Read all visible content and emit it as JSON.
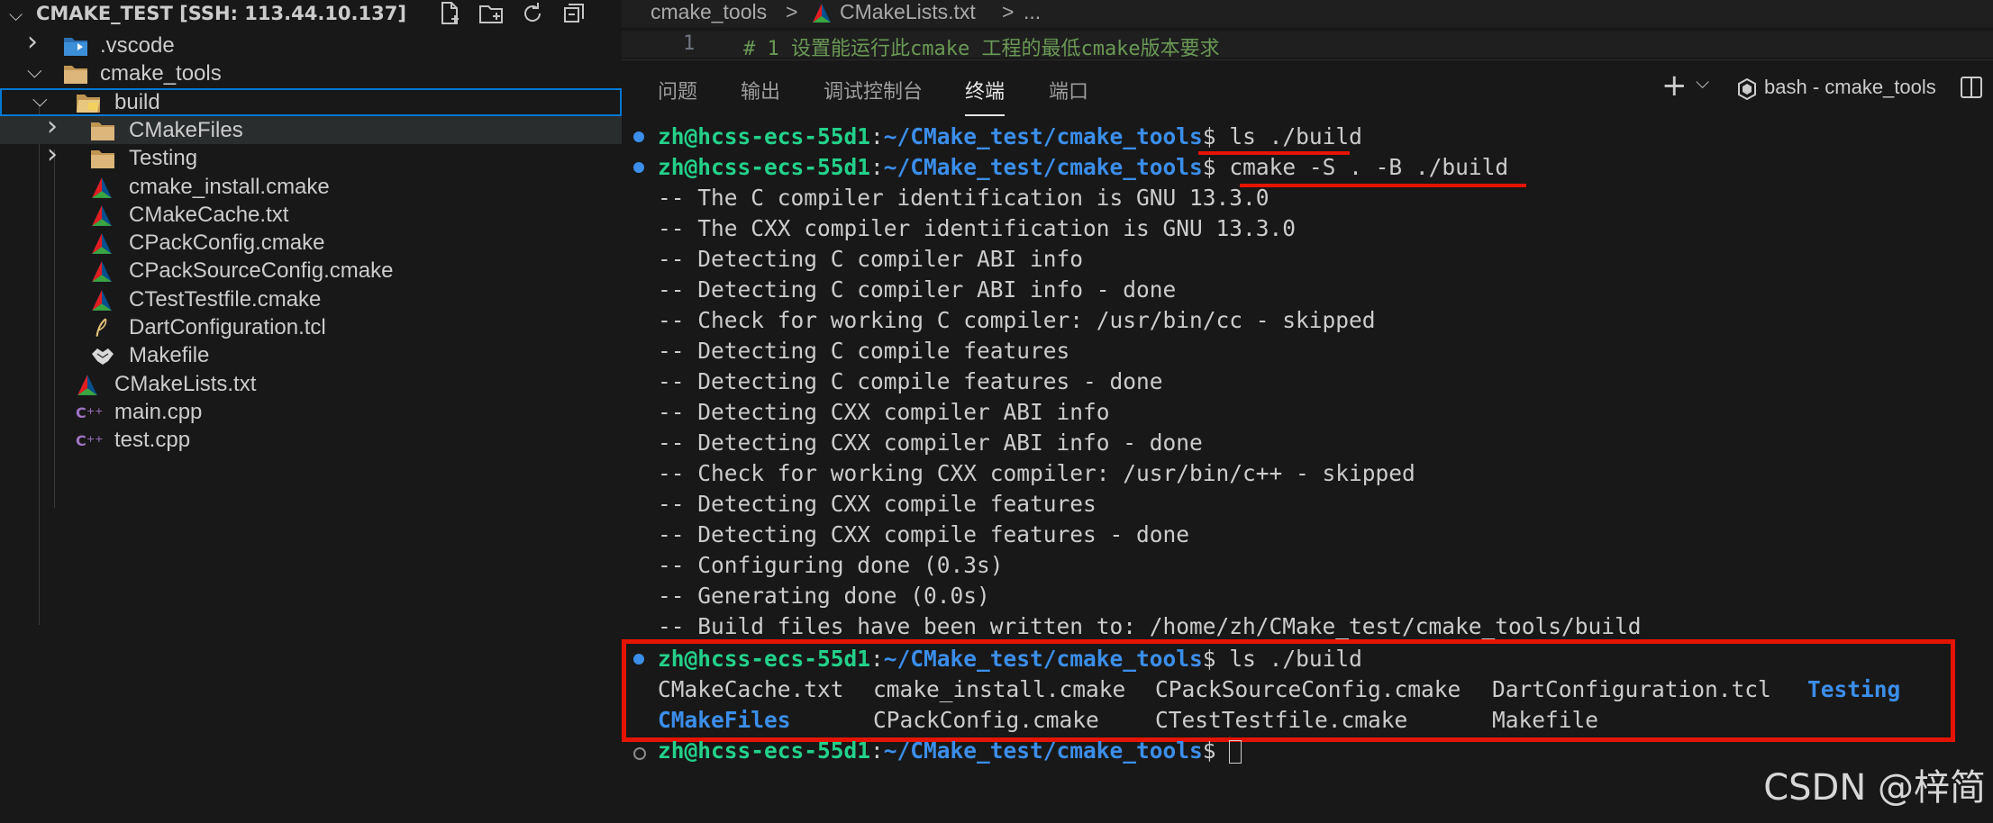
{
  "explorer": {
    "title": "CMAKE_TEST [SSH: 113.44.10.137]",
    "tree": [
      {
        "label": ".vscode",
        "icon": "vscode-folder-icon",
        "level": 1,
        "kind": "folder",
        "expanded": false
      },
      {
        "label": "cmake_tools",
        "icon": "folder-icon",
        "level": 1,
        "kind": "folder",
        "expanded": true
      },
      {
        "label": "build",
        "icon": "build-folder-icon",
        "level": 2,
        "kind": "folder",
        "expanded": true,
        "selected": true
      },
      {
        "label": "CMakeFiles",
        "icon": "folder-icon",
        "level": 3,
        "kind": "folder",
        "expanded": false
      },
      {
        "label": "Testing",
        "icon": "folder-icon",
        "level": 3,
        "kind": "folder",
        "expanded": false
      },
      {
        "label": "cmake_install.cmake",
        "icon": "cmake-icon",
        "level": 3,
        "kind": "file"
      },
      {
        "label": "CMakeCache.txt",
        "icon": "cmake-icon",
        "level": 3,
        "kind": "file"
      },
      {
        "label": "CPackConfig.cmake",
        "icon": "cmake-icon",
        "level": 3,
        "kind": "file"
      },
      {
        "label": "CPackSourceConfig.cmake",
        "icon": "cmake-icon",
        "level": 3,
        "kind": "file"
      },
      {
        "label": "CTestTestfile.cmake",
        "icon": "cmake-icon",
        "level": 3,
        "kind": "file"
      },
      {
        "label": "DartConfiguration.tcl",
        "icon": "feather-icon",
        "level": 3,
        "kind": "file"
      },
      {
        "label": "Makefile",
        "icon": "makefile-icon",
        "level": 3,
        "kind": "file"
      },
      {
        "label": "CMakeLists.txt",
        "icon": "cmake-icon",
        "level": 2,
        "kind": "file"
      },
      {
        "label": "main.cpp",
        "icon": "cpp-icon",
        "level": 2,
        "kind": "file"
      },
      {
        "label": "test.cpp",
        "icon": "cpp-icon",
        "level": 2,
        "kind": "file"
      }
    ]
  },
  "breadcrumb": {
    "folder": "cmake_tools",
    "sep1": ">",
    "file": "CMakeLists.txt",
    "sep2": ">",
    "more": "..."
  },
  "editor": {
    "line_number": "1",
    "line_text": "# 1 设置能运行此cmake 工程的最低cmake版本要求"
  },
  "panel": {
    "tabs": [
      "问题",
      "输出",
      "调试控制台",
      "终端",
      "端口"
    ],
    "active_tab": "终端",
    "terminal_name": "bash - cmake_tools",
    "add_symbol": "+",
    "dropdown_symbol": "⌵"
  },
  "terminal": {
    "prompt_user": "zh@hcss-ecs-55d1",
    "prompt_sep": ":",
    "prompt_path": "~/CMake_test/cmake_tools",
    "prompt_end": "$ ",
    "cmd1": "ls ./build",
    "cmd2": "cmake -S . -B ./build",
    "output": [
      "-- The C compiler identification is GNU 13.3.0",
      "-- The CXX compiler identification is GNU 13.3.0",
      "-- Detecting C compiler ABI info",
      "-- Detecting C compiler ABI info - done",
      "-- Check for working C compiler: /usr/bin/cc - skipped",
      "-- Detecting C compile features",
      "-- Detecting C compile features - done",
      "-- Detecting CXX compiler ABI info",
      "-- Detecting CXX compiler ABI info - done",
      "-- Check for working CXX compiler: /usr/bin/c++ - skipped",
      "-- Detecting CXX compile features",
      "-- Detecting CXX compile features - done",
      "-- Configuring done (0.3s)",
      "-- Generating done (0.0s)",
      "-- Build files have been written to: /home/zh/CMake_test/cmake_tools/build"
    ],
    "cmd3": "ls ./build",
    "ls_row1": [
      {
        "text": "CMakeCache.txt",
        "dir": false
      },
      {
        "text": "cmake_install.cmake",
        "dir": false
      },
      {
        "text": "CPackSourceConfig.cmake",
        "dir": false
      },
      {
        "text": "DartConfiguration.tcl",
        "dir": false
      },
      {
        "text": "Testing",
        "dir": true
      }
    ],
    "ls_row2": [
      {
        "text": "CMakeFiles",
        "dir": true
      },
      {
        "text": "CPackConfig.cmake",
        "dir": false
      },
      {
        "text": "CTestTestfile.cmake",
        "dir": false
      },
      {
        "text": "Makefile",
        "dir": false
      }
    ]
  },
  "colors": {
    "accent": "#0078d4",
    "highlight_red": "#e51400",
    "prompt_green": "#23d18b",
    "path_blue": "#3b8eea"
  },
  "watermark": "CSDN @梓简"
}
